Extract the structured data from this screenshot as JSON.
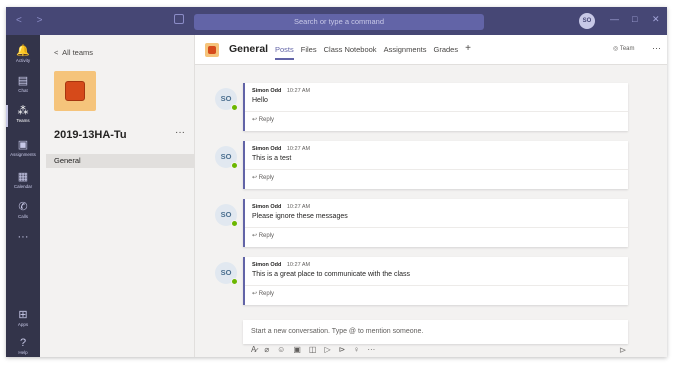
{
  "window": {
    "search_placeholder": "Search or type a command",
    "user_initials": "SO"
  },
  "rail": [
    {
      "label": "Activity",
      "icon": "bell-icon",
      "glyph": "🔔"
    },
    {
      "label": "Chat",
      "icon": "chat-icon",
      "glyph": "▤"
    },
    {
      "label": "Teams",
      "icon": "teams-icon",
      "glyph": "⁂"
    },
    {
      "label": "Assignments",
      "icon": "assignments-icon",
      "glyph": "▣"
    },
    {
      "label": "Calendar",
      "icon": "calendar-icon",
      "glyph": "▦"
    },
    {
      "label": "Calls",
      "icon": "phone-icon",
      "glyph": "✆"
    },
    {
      "label": "Apps",
      "icon": "apps-icon",
      "glyph": "⊞"
    },
    {
      "label": "Help",
      "icon": "help-icon",
      "glyph": "?"
    }
  ],
  "teampane": {
    "back_label": "All teams",
    "team_name": "2019-13HA-Tu",
    "more": "···",
    "channels": [
      "General"
    ]
  },
  "header": {
    "channel": "General",
    "tabs": [
      "Posts",
      "Files",
      "Class Notebook",
      "Assignments",
      "Grades"
    ],
    "active_tab": "Posts",
    "add_tab": "+",
    "team_button": "Team",
    "more": "···"
  },
  "posts": [
    {
      "initials": "SO",
      "author": "Simon Odd",
      "time": "10:27 AM",
      "text": "Hello",
      "reply": "Reply"
    },
    {
      "initials": "SO",
      "author": "Simon Odd",
      "time": "10:27 AM",
      "text": "This is a test",
      "reply": "Reply"
    },
    {
      "initials": "SO",
      "author": "Simon Odd",
      "time": "10:27 AM",
      "text": "Please ignore these messages",
      "reply": "Reply"
    },
    {
      "initials": "SO",
      "author": "Simon Odd",
      "time": "10:27 AM",
      "text": "This is a great place to communicate with the class",
      "reply": "Reply"
    }
  ],
  "composer": {
    "placeholder": "Start a new conversation. Type @ to mention someone.",
    "more": "···"
  },
  "colors": {
    "brand": "#6264a7",
    "titlebar": "#464775",
    "rail": "#33344a",
    "presence": "#6bb700"
  }
}
